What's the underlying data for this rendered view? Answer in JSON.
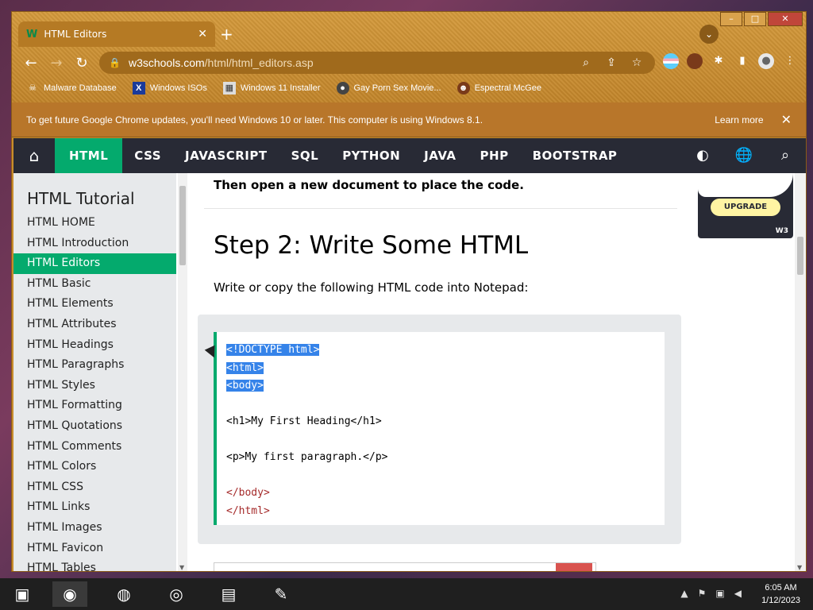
{
  "window": {
    "controls": {
      "minimize": "–",
      "maximize": "□",
      "close": "✕"
    }
  },
  "tab": {
    "favicon": "W",
    "title": "HTML Editors",
    "close": "✕",
    "new_tab": "+",
    "menu": "⌄"
  },
  "nav": {
    "back": "←",
    "forward": "→",
    "reload": "↻",
    "lock": "🔒",
    "url_host": "w3schools.com",
    "url_path": "/html/html_editors.asp",
    "zoom_icon": "⌕",
    "share_icon": "⇪",
    "star_icon": "☆",
    "extensions_icon": "✱",
    "sidepanel_icon": "▮",
    "menu_icon": "⋮"
  },
  "bookmarks": [
    {
      "icon": "☠",
      "label": "Malware Database"
    },
    {
      "icon": "X",
      "label": "Windows ISOs"
    },
    {
      "icon": "▦",
      "label": "Windows 11 Installer"
    },
    {
      "icon": "●",
      "label": "Gay Porn Sex Movie..."
    },
    {
      "icon": "☻",
      "label": "Espectral McGee"
    }
  ],
  "infobar": {
    "message": "To get future Google Chrome updates, you'll need Windows 10 or later. This computer is using Windows 8.1.",
    "learn_more": "Learn more",
    "close": "✕"
  },
  "topnav": {
    "home_icon": "⌂",
    "links": [
      "HTML",
      "CSS",
      "JAVASCRIPT",
      "SQL",
      "PYTHON",
      "JAVA",
      "PHP",
      "BOOTSTRAP"
    ],
    "active": "HTML",
    "contrast_icon": "◐",
    "globe_icon": "🌐",
    "search_icon": "⌕"
  },
  "sidebar": {
    "title": "HTML Tutorial",
    "items": [
      "HTML HOME",
      "HTML Introduction",
      "HTML Editors",
      "HTML Basic",
      "HTML Elements",
      "HTML Attributes",
      "HTML Headings",
      "HTML Paragraphs",
      "HTML Styles",
      "HTML Formatting",
      "HTML Quotations",
      "HTML Comments",
      "HTML Colors",
      "HTML CSS",
      "HTML Links",
      "HTML Images",
      "HTML Favicon",
      "HTML Tables"
    ],
    "active_index": 2
  },
  "main": {
    "lead": "Then open a new document to place the code.",
    "heading": "Step 2: Write Some HTML",
    "description": "Write or copy the following HTML code into Notepad:",
    "code": [
      "<!DOCTYPE html>",
      "<html>",
      "<body>",
      "",
      "<h1>My First Heading</h1>",
      "",
      "<p>My first paragraph.</p>",
      "",
      "</body>",
      "</html>"
    ],
    "selected_lines": 3
  },
  "ad": {
    "button": "UPGRADE",
    "logo": "W3"
  },
  "taskbar": {
    "clock_time": "6:05 AM",
    "clock_date": "1/12/2023",
    "tray_up": "▲",
    "tray_flag": "⚑",
    "tray_network": "▣",
    "tray_volume": "◀"
  },
  "colors": {
    "w3_green": "#04aa6d",
    "w3_dark": "#282a35",
    "chrome_theme": "#c98c2c",
    "selection": "#3583e9"
  }
}
